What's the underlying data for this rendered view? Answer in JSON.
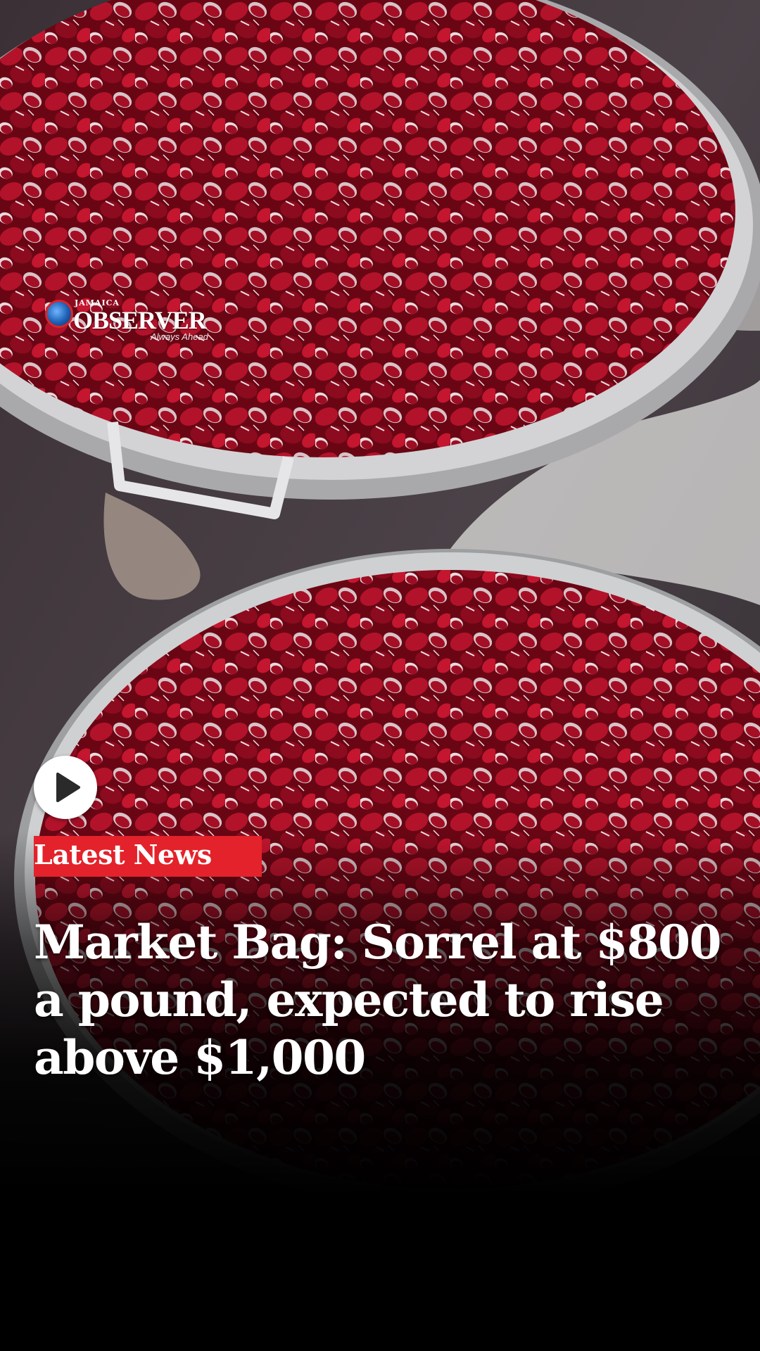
{
  "brand": {
    "small_text": "JAMAICA",
    "name": "OBSERVER",
    "tagline": "Always Ahead"
  },
  "media": {
    "play_icon": "play-icon",
    "photo_subject": "sorrel-in-pots"
  },
  "badge": {
    "label": "Latest News",
    "color": "#e3222b"
  },
  "article": {
    "headline": "Market Bag: Sorrel at $800 a pound, expected to rise above $1,000"
  }
}
